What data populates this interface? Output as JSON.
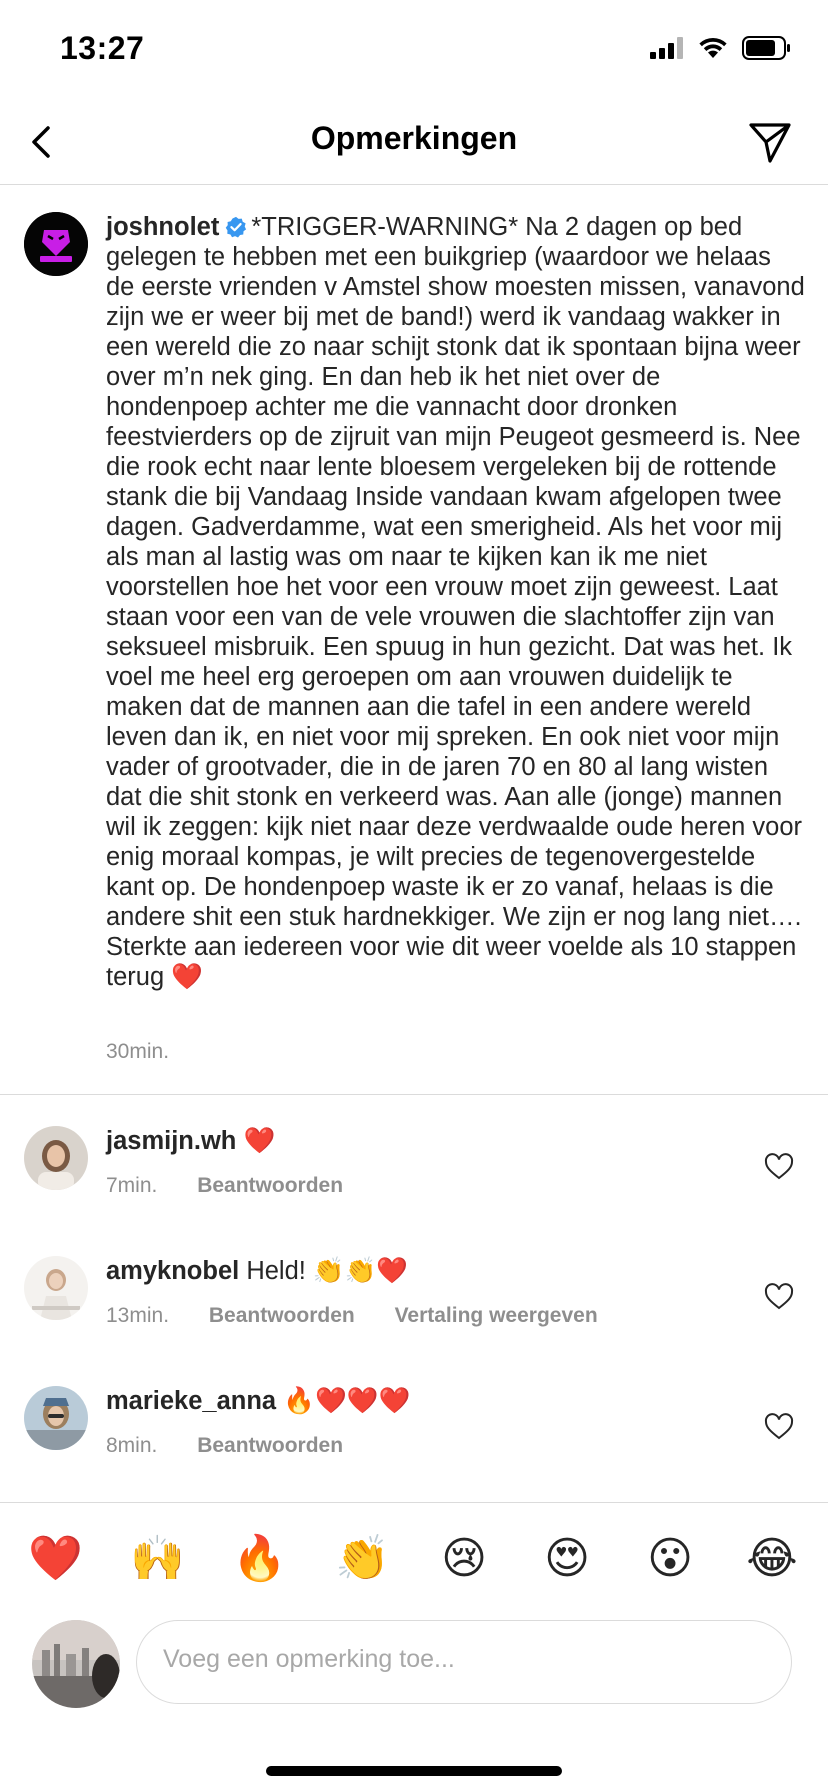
{
  "status_bar": {
    "time": "13:27"
  },
  "header": {
    "title": "Opmerkingen"
  },
  "caption": {
    "username": "joshnolet",
    "text": "*TRIGGER-WARNING* Na 2 dagen op bed gelegen te hebben met een buikgriep (waardoor we helaas de eerste vrienden v Amstel show moesten missen, vanavond zijn we er weer bij met de band!) werd ik vandaag wakker in een wereld die zo naar schijt stonk dat ik spontaan bijna weer over m’n nek ging. En dan heb ik het niet over de hondenpoep achter me die vannacht door dronken feestvierders op de zijruit van mijn Peugeot gesmeerd is. Nee die rook echt naar lente bloesem vergeleken bij de rottende stank die bij Vandaag Inside vandaan kwam afgelopen twee dagen. Gadverdamme, wat een smerigheid. Als het voor mij als man al lastig was om naar te kijken kan ik me niet voorstellen hoe het voor een vrouw moet zijn geweest. Laat staan voor een van de vele vrouwen die slachtoffer zijn van seksueel misbruik. Een spuug in hun gezicht. Dat was het. Ik voel me heel erg geroepen om aan vrouwen duidelijk te maken dat de mannen aan die tafel in een andere wereld leven dan ik, en niet voor mij spreken. En ook niet voor mijn vader of grootvader, die in de jaren 70 en 80 al lang wisten dat die shit stonk en verkeerd was. Aan alle (jonge) mannen wil ik zeggen: kijk niet naar deze verdwaalde oude heren voor enig moraal kompas, je wilt precies de tegenovergestelde kant op. De hondenpoep waste ik er zo vanaf, helaas is die andere shit een stuk hardnekkiger. We zijn er nog lang niet…. Sterkte aan iedereen voor wie dit weer voelde als 10 stappen terug ❤️",
    "time": "30min."
  },
  "comments": [
    {
      "username": "jasmijn.wh",
      "text": "❤️",
      "time": "7min.",
      "reply": "Beantwoorden",
      "translate": ""
    },
    {
      "username": "amyknobel",
      "text": "Held! 👏👏❤️",
      "time": "13min.",
      "reply": "Beantwoorden",
      "translate": "Vertaling weergeven"
    },
    {
      "username": "marieke_anna",
      "text": "🔥❤️❤️❤️",
      "time": "8min.",
      "reply": "Beantwoorden",
      "translate": ""
    }
  ],
  "quick_reactions": [
    "❤️",
    "🙌",
    "🔥",
    "👏",
    "😢",
    "😍",
    "😮",
    "😂"
  ],
  "composer": {
    "placeholder": "Voeg een opmerking toe..."
  },
  "colors": {
    "text": "#262626",
    "secondary": "#8e8e8e",
    "divider": "#dbdbdb",
    "verified": "#3897f0",
    "brand_purple": "#c81ee6"
  }
}
